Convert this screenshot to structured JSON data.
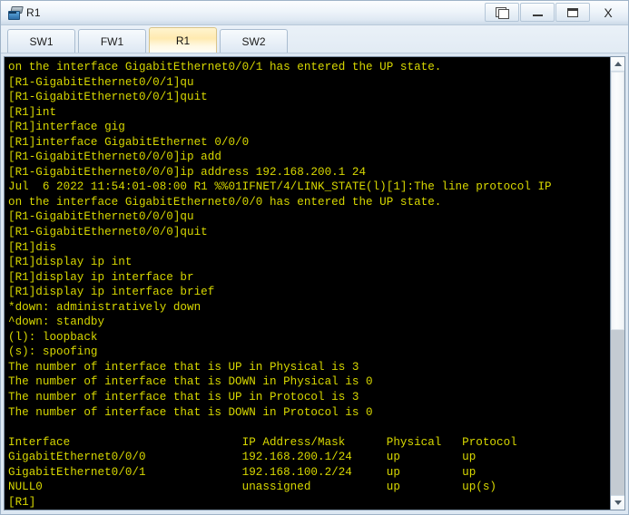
{
  "window": {
    "title": "R1",
    "icon": "router-icon",
    "controls": [
      {
        "name": "restore-button",
        "label": ""
      },
      {
        "name": "minimize-button",
        "label": ""
      },
      {
        "name": "maximize-button",
        "label": ""
      },
      {
        "name": "close-button",
        "label": "X"
      }
    ]
  },
  "tabs": [
    {
      "label": "SW1",
      "active": false
    },
    {
      "label": "FW1",
      "active": false
    },
    {
      "label": "R1",
      "active": true
    },
    {
      "label": "SW2",
      "active": false
    }
  ],
  "terminal": {
    "foreground_color": "#d8d800",
    "background_color": "#000000",
    "lines": [
      "on the interface GigabitEthernet0/0/1 has entered the UP state.",
      "[R1-GigabitEthernet0/0/1]qu",
      "[R1-GigabitEthernet0/0/1]quit",
      "[R1]int",
      "[R1]interface gig",
      "[R1]interface GigabitEthernet 0/0/0",
      "[R1-GigabitEthernet0/0/0]ip add",
      "[R1-GigabitEthernet0/0/0]ip address 192.168.200.1 24",
      "Jul  6 2022 11:54:01-08:00 R1 %%01IFNET/4/LINK_STATE(l)[1]:The line protocol IP",
      "on the interface GigabitEthernet0/0/0 has entered the UP state.",
      "[R1-GigabitEthernet0/0/0]qu",
      "[R1-GigabitEthernet0/0/0]quit",
      "[R1]dis",
      "[R1]display ip int",
      "[R1]display ip interface br",
      "[R1]display ip interface brief",
      "*down: administratively down",
      "^down: standby",
      "(l): loopback",
      "(s): spoofing",
      "The number of interface that is UP in Physical is 3",
      "The number of interface that is DOWN in Physical is 0",
      "The number of interface that is UP in Protocol is 3",
      "The number of interface that is DOWN in Protocol is 0",
      "",
      "Interface                         IP Address/Mask      Physical   Protocol",
      "GigabitEthernet0/0/0              192.168.200.1/24     up         up",
      "GigabitEthernet0/0/1              192.168.100.2/24     up         up",
      "NULL0                             unassigned           up         up(s)",
      "[R1]"
    ],
    "interface_table": {
      "columns": [
        "Interface",
        "IP Address/Mask",
        "Physical",
        "Protocol"
      ],
      "rows": [
        [
          "GigabitEthernet0/0/0",
          "192.168.200.1/24",
          "up",
          "up"
        ],
        [
          "GigabitEthernet0/0/1",
          "192.168.100.2/24",
          "up",
          "up"
        ],
        [
          "NULL0",
          "unassigned",
          "up",
          "up(s)"
        ]
      ]
    },
    "prompt": "[R1]"
  },
  "scrollbar": {
    "up_arrow": "chevron-up-icon",
    "down_arrow": "chevron-down-icon",
    "thumb_size_percent": "61"
  }
}
